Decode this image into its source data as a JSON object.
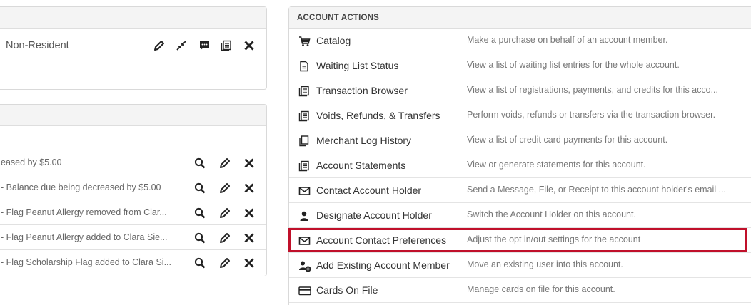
{
  "member_panel": {
    "residency": "Non-Resident"
  },
  "history_panel": {
    "rows": [
      {
        "text": "eased by $5.00"
      },
      {
        "text": "- Balance due being decreased by $5.00"
      },
      {
        "text": "- Flag Peanut Allergy removed from Clar..."
      },
      {
        "text": "- Flag Peanut Allergy added to Clara Sie..."
      },
      {
        "text": "- Flag Scholarship Flag added to Clara Si..."
      }
    ]
  },
  "account_actions": {
    "title": "ACCOUNT ACTIONS",
    "items": [
      {
        "label": "Catalog",
        "description": "Make a purchase on behalf of an account member.",
        "icon": "cart-icon"
      },
      {
        "label": "Waiting List Status",
        "description": "View a list of waiting list entries for the whole account.",
        "icon": "document-icon"
      },
      {
        "label": "Transaction Browser",
        "description": "View a list of registrations, payments, and credits for this acco...",
        "icon": "receipt-icon"
      },
      {
        "label": "Voids, Refunds, & Transfers",
        "description": "Perform voids, refunds or transfers via the transaction browser.",
        "icon": "receipt-icon"
      },
      {
        "label": "Merchant Log History",
        "description": "View a list of credit card payments for this account.",
        "icon": "copy-icon"
      },
      {
        "label": "Account Statements",
        "description": "View or generate statements for this account.",
        "icon": "receipt-icon"
      },
      {
        "label": "Contact Account Holder",
        "description": "Send a Message, File, or Receipt to this account holder's email ...",
        "icon": "envelope-icon"
      },
      {
        "label": "Designate Account Holder",
        "description": "Switch the Account Holder on this account.",
        "icon": "user-icon"
      },
      {
        "label": "Account Contact Preferences",
        "description": "Adjust the opt in/out settings for the account",
        "icon": "envelope-icon"
      },
      {
        "label": "Add Existing Account Member",
        "description": "Move an existing user into this account.",
        "icon": "add-user-icon"
      },
      {
        "label": "Cards On File",
        "description": "Manage cards on file for this account.",
        "icon": "credit-card-icon"
      }
    ]
  },
  "colors": {
    "highlight": "#c0102a",
    "panel_header_bg": "#f4f4f4",
    "border": "#d9d9d9"
  }
}
